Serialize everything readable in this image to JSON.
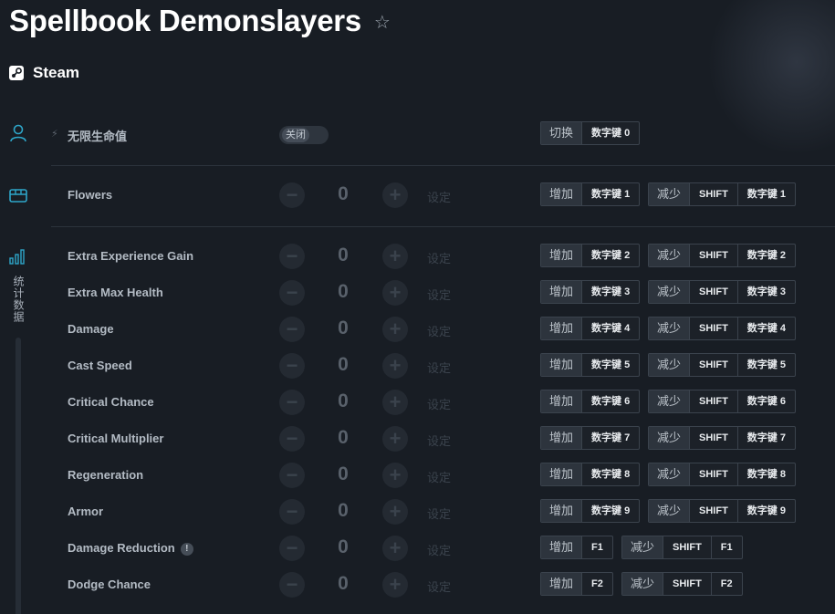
{
  "app": {
    "title": "Spellbook Demonslayers",
    "platform": "Steam"
  },
  "sidebar": {
    "items": [
      {
        "icon": "user-icon"
      },
      {
        "icon": "chest-icon"
      },
      {
        "icon": "stats-icon",
        "label": "统计数据"
      }
    ]
  },
  "labels": {
    "toggle_off": "关闭",
    "set": "设定",
    "minus": "−",
    "plus": "+"
  },
  "cheats": [
    {
      "name": "无限生命值",
      "type": "toggle",
      "state": "关闭",
      "hotkeys": [
        {
          "action": "切换",
          "keys": [
            "数字键 0"
          ]
        }
      ]
    },
    {
      "name": "Flowers",
      "type": "stepper",
      "value": "0",
      "hotkeys": [
        {
          "action": "增加",
          "keys": [
            "数字键 1"
          ]
        },
        {
          "action": "减少",
          "keys": [
            "SHIFT",
            "数字键 1"
          ]
        }
      ]
    },
    {
      "name": "Extra Experience Gain",
      "type": "stepper",
      "value": "0",
      "hotkeys": [
        {
          "action": "增加",
          "keys": [
            "数字键 2"
          ]
        },
        {
          "action": "减少",
          "keys": [
            "SHIFT",
            "数字键 2"
          ]
        }
      ]
    },
    {
      "name": "Extra Max Health",
      "type": "stepper",
      "value": "0",
      "hotkeys": [
        {
          "action": "增加",
          "keys": [
            "数字键 3"
          ]
        },
        {
          "action": "减少",
          "keys": [
            "SHIFT",
            "数字键 3"
          ]
        }
      ]
    },
    {
      "name": "Damage",
      "type": "stepper",
      "value": "0",
      "hotkeys": [
        {
          "action": "增加",
          "keys": [
            "数字键 4"
          ]
        },
        {
          "action": "减少",
          "keys": [
            "SHIFT",
            "数字键 4"
          ]
        }
      ]
    },
    {
      "name": "Cast Speed",
      "type": "stepper",
      "value": "0",
      "hotkeys": [
        {
          "action": "增加",
          "keys": [
            "数字键 5"
          ]
        },
        {
          "action": "减少",
          "keys": [
            "SHIFT",
            "数字键 5"
          ]
        }
      ]
    },
    {
      "name": "Critical Chance",
      "type": "stepper",
      "value": "0",
      "hotkeys": [
        {
          "action": "增加",
          "keys": [
            "数字键 6"
          ]
        },
        {
          "action": "减少",
          "keys": [
            "SHIFT",
            "数字键 6"
          ]
        }
      ]
    },
    {
      "name": "Critical Multiplier",
      "type": "stepper",
      "value": "0",
      "hotkeys": [
        {
          "action": "增加",
          "keys": [
            "数字键 7"
          ]
        },
        {
          "action": "减少",
          "keys": [
            "SHIFT",
            "数字键 7"
          ]
        }
      ]
    },
    {
      "name": "Regeneration",
      "type": "stepper",
      "value": "0",
      "hotkeys": [
        {
          "action": "增加",
          "keys": [
            "数字键 8"
          ]
        },
        {
          "action": "减少",
          "keys": [
            "SHIFT",
            "数字键 8"
          ]
        }
      ]
    },
    {
      "name": "Armor",
      "type": "stepper",
      "value": "0",
      "hotkeys": [
        {
          "action": "增加",
          "keys": [
            "数字键 9"
          ]
        },
        {
          "action": "减少",
          "keys": [
            "SHIFT",
            "数字键 9"
          ]
        }
      ]
    },
    {
      "name": "Damage Reduction",
      "type": "stepper",
      "value": "0",
      "info": "!",
      "hotkeys": [
        {
          "action": "增加",
          "keys": [
            "F1"
          ]
        },
        {
          "action": "减少",
          "keys": [
            "SHIFT",
            "F1"
          ]
        }
      ]
    },
    {
      "name": "Dodge Chance",
      "type": "stepper",
      "value": "0",
      "hotkeys": [
        {
          "action": "增加",
          "keys": [
            "F2"
          ]
        },
        {
          "action": "减少",
          "keys": [
            "SHIFT",
            "F2"
          ]
        }
      ]
    }
  ]
}
